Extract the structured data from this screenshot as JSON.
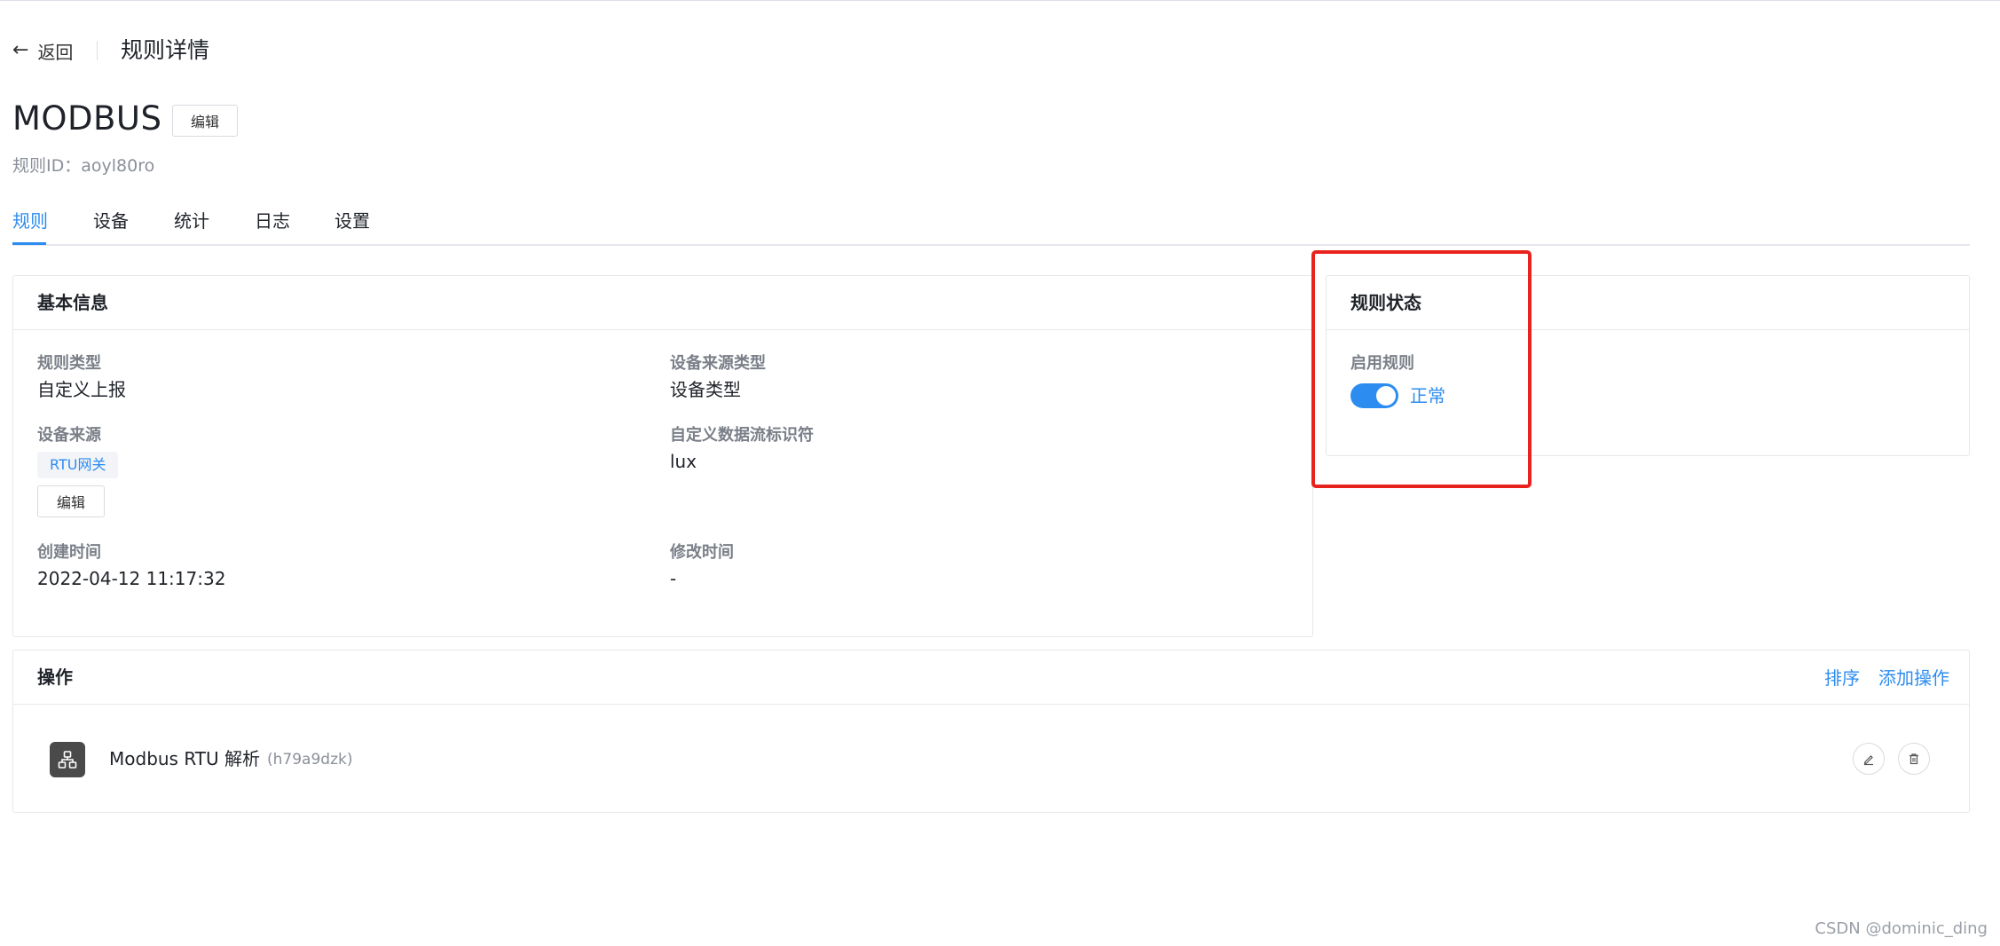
{
  "header": {
    "back_label": "返回",
    "page_title": "规则详情"
  },
  "rule": {
    "name": "MODBUS",
    "edit_label": "编辑",
    "id_label": "规则ID：",
    "id_value": "aoyl80ro"
  },
  "tabs": [
    {
      "label": "规则",
      "active": true
    },
    {
      "label": "设备",
      "active": false
    },
    {
      "label": "统计",
      "active": false
    },
    {
      "label": "日志",
      "active": false
    },
    {
      "label": "设置",
      "active": false
    }
  ],
  "basic_info": {
    "title": "基本信息",
    "rule_type": {
      "label": "规则类型",
      "value": "自定义上报"
    },
    "device_source_type": {
      "label": "设备来源类型",
      "value": "设备类型"
    },
    "device_source": {
      "label": "设备来源",
      "tag": "RTU网关",
      "edit_label": "编辑"
    },
    "custom_stream_id": {
      "label": "自定义数据流标识符",
      "value": "lux"
    },
    "created_time": {
      "label": "创建时间",
      "value": "2022-04-12 11:17:32"
    },
    "modified_time": {
      "label": "修改时间",
      "value": "-"
    }
  },
  "rule_status": {
    "title": "规则状态",
    "enable_label": "启用规则",
    "enabled": true,
    "status_text": "正常"
  },
  "operations": {
    "title": "操作",
    "sort_label": "排序",
    "add_label": "添加操作",
    "items": [
      {
        "name": "Modbus RTU 解析",
        "id": "(h79a9dzk)",
        "icon": "network-icon"
      }
    ]
  },
  "colors": {
    "accent": "#2d8cf0",
    "highlight": "#e8231e"
  },
  "watermark": "CSDN @dominic_ding"
}
